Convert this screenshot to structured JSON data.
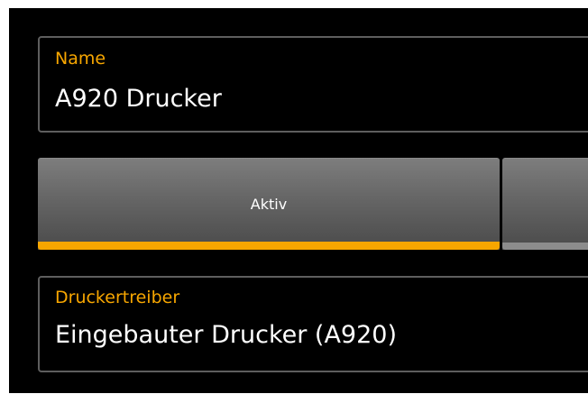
{
  "form": {
    "name_field": {
      "label": "Name",
      "value": "A920 Drucker"
    },
    "toggle_buttons": [
      {
        "label": "Aktiv",
        "selected": true
      },
      {
        "label": "",
        "selected": false
      }
    ],
    "driver_field": {
      "label": "Druckertreiber",
      "value": "Eingebauter Drucker (A920)"
    }
  },
  "colors": {
    "accent": "#f7a600",
    "background": "#000000",
    "text": "#ffffff",
    "border": "#5e5e5e"
  }
}
